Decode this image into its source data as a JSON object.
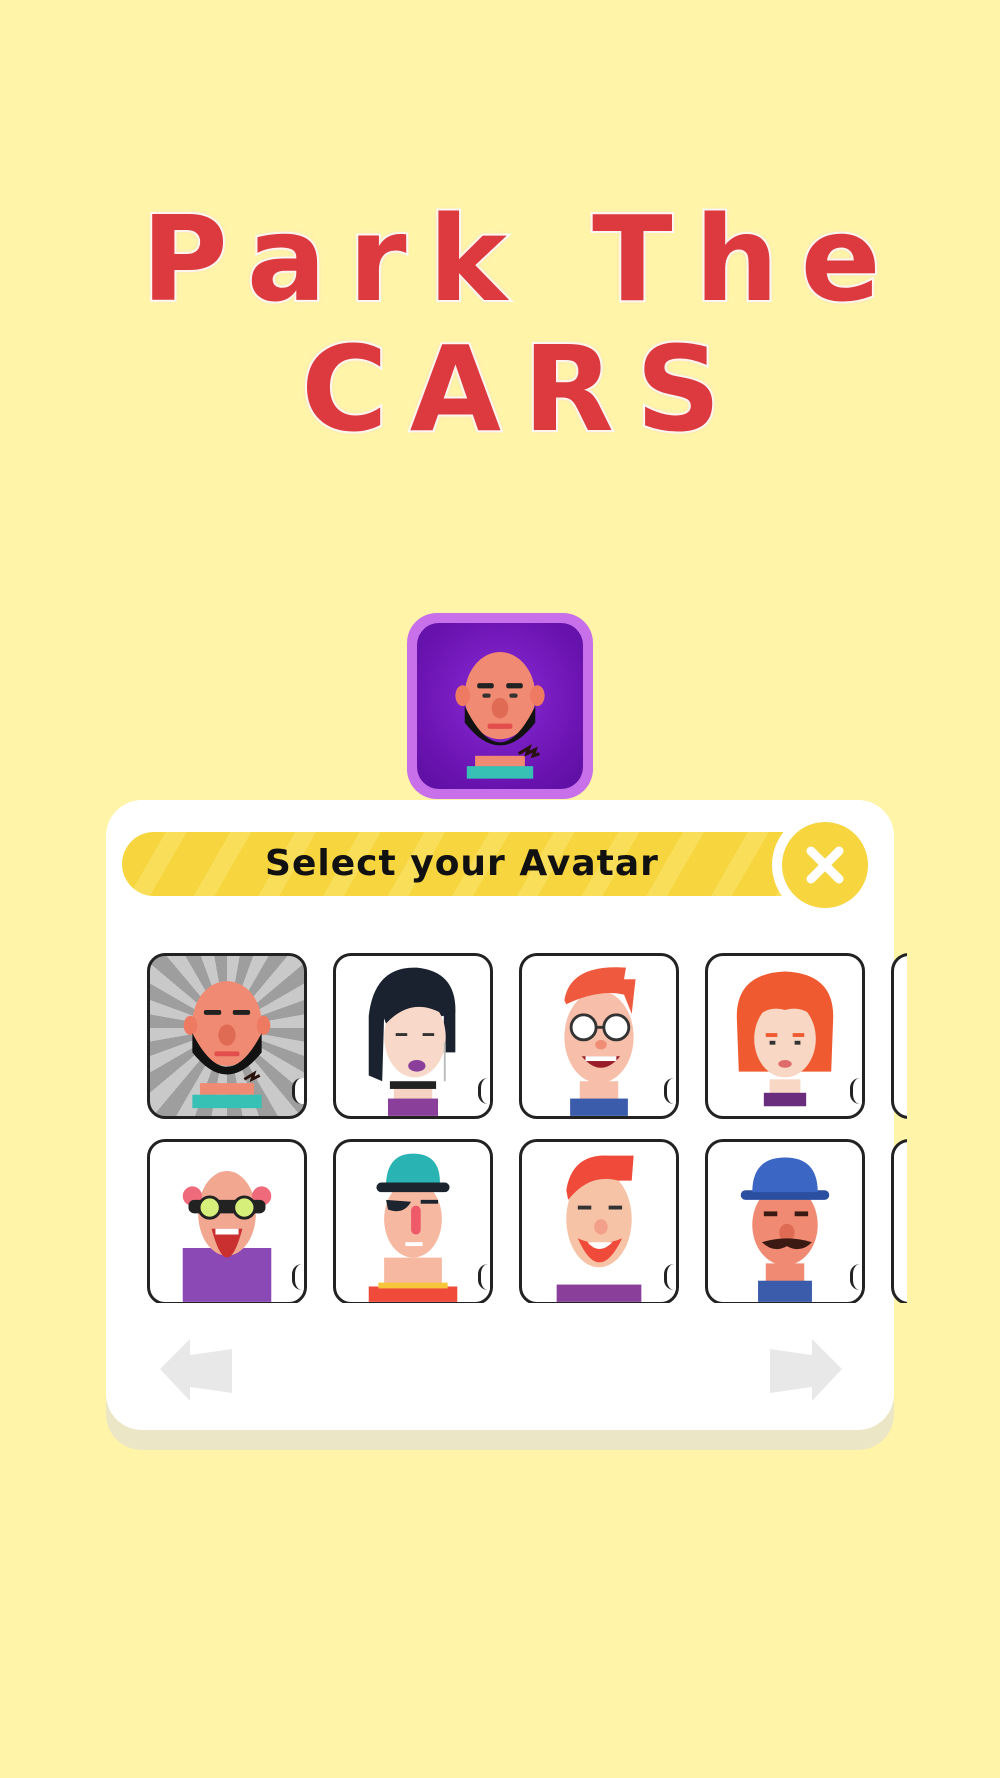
{
  "game": {
    "title_line1": "Park The",
    "title_line2": "CARS"
  },
  "colors": {
    "background": "#fff4a8",
    "title_red": "#dc3a3e",
    "header_yellow": "#f6d53f",
    "current_frame": "#c770ea",
    "current_bg": "#6a13b0"
  },
  "current_avatar": {
    "name": "bald-bearded-man"
  },
  "panel": {
    "title": "Select your Avatar",
    "close_icon": "close-x-icon",
    "prev_icon": "arrow-left-icon",
    "next_icon": "arrow-right-icon"
  },
  "avatars": [
    {
      "name": "bald-bearded-man",
      "selected": true
    },
    {
      "name": "dark-haired-woman",
      "selected": false
    },
    {
      "name": "redhead-glasses-man",
      "selected": false
    },
    {
      "name": "curly-redhead-woman",
      "selected": false
    },
    {
      "name": "goggles-old-man",
      "selected": false
    },
    {
      "name": "teal-hat-man",
      "selected": false
    },
    {
      "name": "red-beard-man",
      "selected": false
    },
    {
      "name": "blue-cap-mustache-man",
      "selected": false
    }
  ]
}
